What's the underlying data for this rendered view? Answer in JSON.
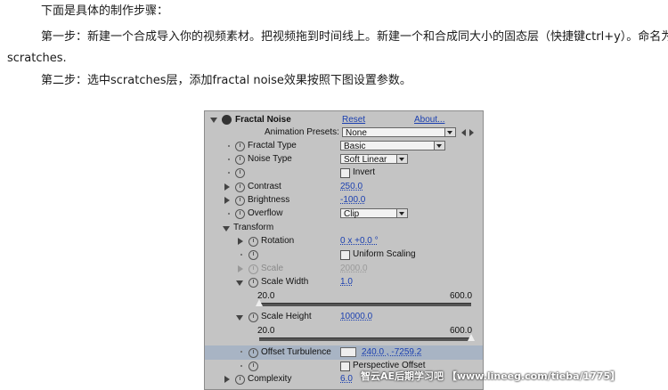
{
  "article": {
    "p1": "下面是具体的制作步骤：",
    "p2_line1": "第一步：新建一个合成导入你的视频素材。把视频拖到时间线上。新建一个和合成同大小的固态层（快捷键ctrl+y）。命名为",
    "p2_line2": "scratches.",
    "p3": "第二步：选中scratches层，添加fractal noise效果按照下图设置参数。"
  },
  "panel": {
    "effect_name": "Fractal Noise",
    "reset_label": "Reset",
    "about_label": "About...",
    "presets_label": "Animation Presets:",
    "presets_value": "None",
    "rows": {
      "fractal_type": {
        "label": "Fractal Type",
        "value": "Basic"
      },
      "noise_type": {
        "label": "Noise Type",
        "value": "Soft Linear"
      },
      "invert": {
        "label": "Invert"
      },
      "contrast": {
        "label": "Contrast",
        "value": "250.0"
      },
      "brightness": {
        "label": "Brightness",
        "value": "-100.0"
      },
      "overflow": {
        "label": "Overflow",
        "value": "Clip"
      },
      "transform": {
        "label": "Transform"
      },
      "rotation": {
        "label": "Rotation",
        "value": "0 x +0.0 °"
      },
      "uniform_scaling": {
        "label": "Uniform Scaling"
      },
      "scale": {
        "label": "Scale",
        "value": "2000.0"
      },
      "scale_width": {
        "label": "Scale Width",
        "value": "1.0",
        "min": "20.0",
        "max": "600.0",
        "slider_fraction": 0.0
      },
      "scale_height": {
        "label": "Scale Height",
        "value": "10000.0",
        "min": "20.0",
        "max": "600.0",
        "slider_fraction": 1.0
      },
      "offset_turbulence": {
        "label": "Offset Turbulence",
        "value": "240.0 , -7259.2"
      },
      "perspective_offset": {
        "label": "Perspective Offset"
      },
      "complexity": {
        "label": "Complexity",
        "value": "6.0"
      }
    }
  },
  "watermark": "智云AE后期学习吧 【www.lineeg.com/tieba/1775】"
}
